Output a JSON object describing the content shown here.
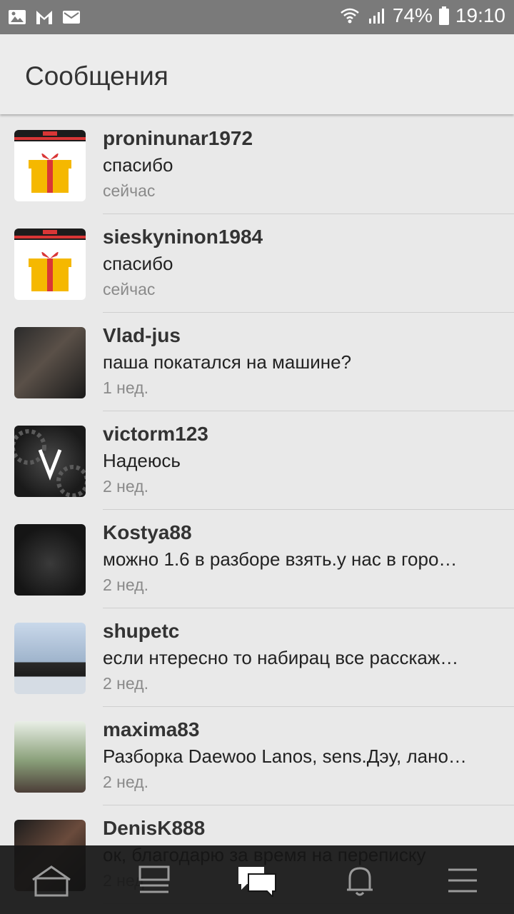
{
  "status_bar": {
    "battery": "74%",
    "time": "19:10",
    "left_icons": [
      "image-icon",
      "gmail-icon",
      "mail-icon"
    ],
    "right_icons": [
      "wifi-icon",
      "signal-icon",
      "battery-icon"
    ]
  },
  "header": {
    "title": "Сообщения"
  },
  "messages": [
    {
      "name": "proninunar1972",
      "text": "спасибо",
      "time": "сейчас",
      "avatar": "gift-avatar"
    },
    {
      "name": "sieskyninon1984",
      "text": "спасибо",
      "time": "сейчас",
      "avatar": "gift-avatar"
    },
    {
      "name": "Vlad-jus",
      "text": "паша покатался на машине?",
      "time": "1 нед.",
      "avatar": "photo-avatar"
    },
    {
      "name": "victorm123",
      "text": "Надеюсь",
      "time": "2 нед.",
      "avatar": "gear-v-avatar"
    },
    {
      "name": "Kostya88",
      "text": "можно 1.6 в разборе взять.у нас в горо…",
      "time": "2 нед.",
      "avatar": "car-avatar"
    },
    {
      "name": "shupetc",
      "text": "если нтересно то набирац все расскаж…",
      "time": "2 нед.",
      "avatar": "photo-avatar"
    },
    {
      "name": "maxima83",
      "text": "Разборка Daewoo Lanos, sens.Дэу, лано…",
      "time": "2 нед.",
      "avatar": "photo-avatar"
    },
    {
      "name": "DenisK888",
      "text": "ок, благодарю за время на переписку",
      "time": "2 нед.",
      "avatar": "photo-avatar"
    }
  ],
  "bottom_nav": [
    "home-icon",
    "feed-icon",
    "messages-icon",
    "bell-icon",
    "menu-icon"
  ],
  "colors": {
    "status_bar": "#7a7a7a",
    "app_bar": "#ececec",
    "background": "#e9e9e9",
    "bottom_nav": "#161616",
    "gift_yellow": "#f5b800",
    "gift_red": "#d93636"
  }
}
